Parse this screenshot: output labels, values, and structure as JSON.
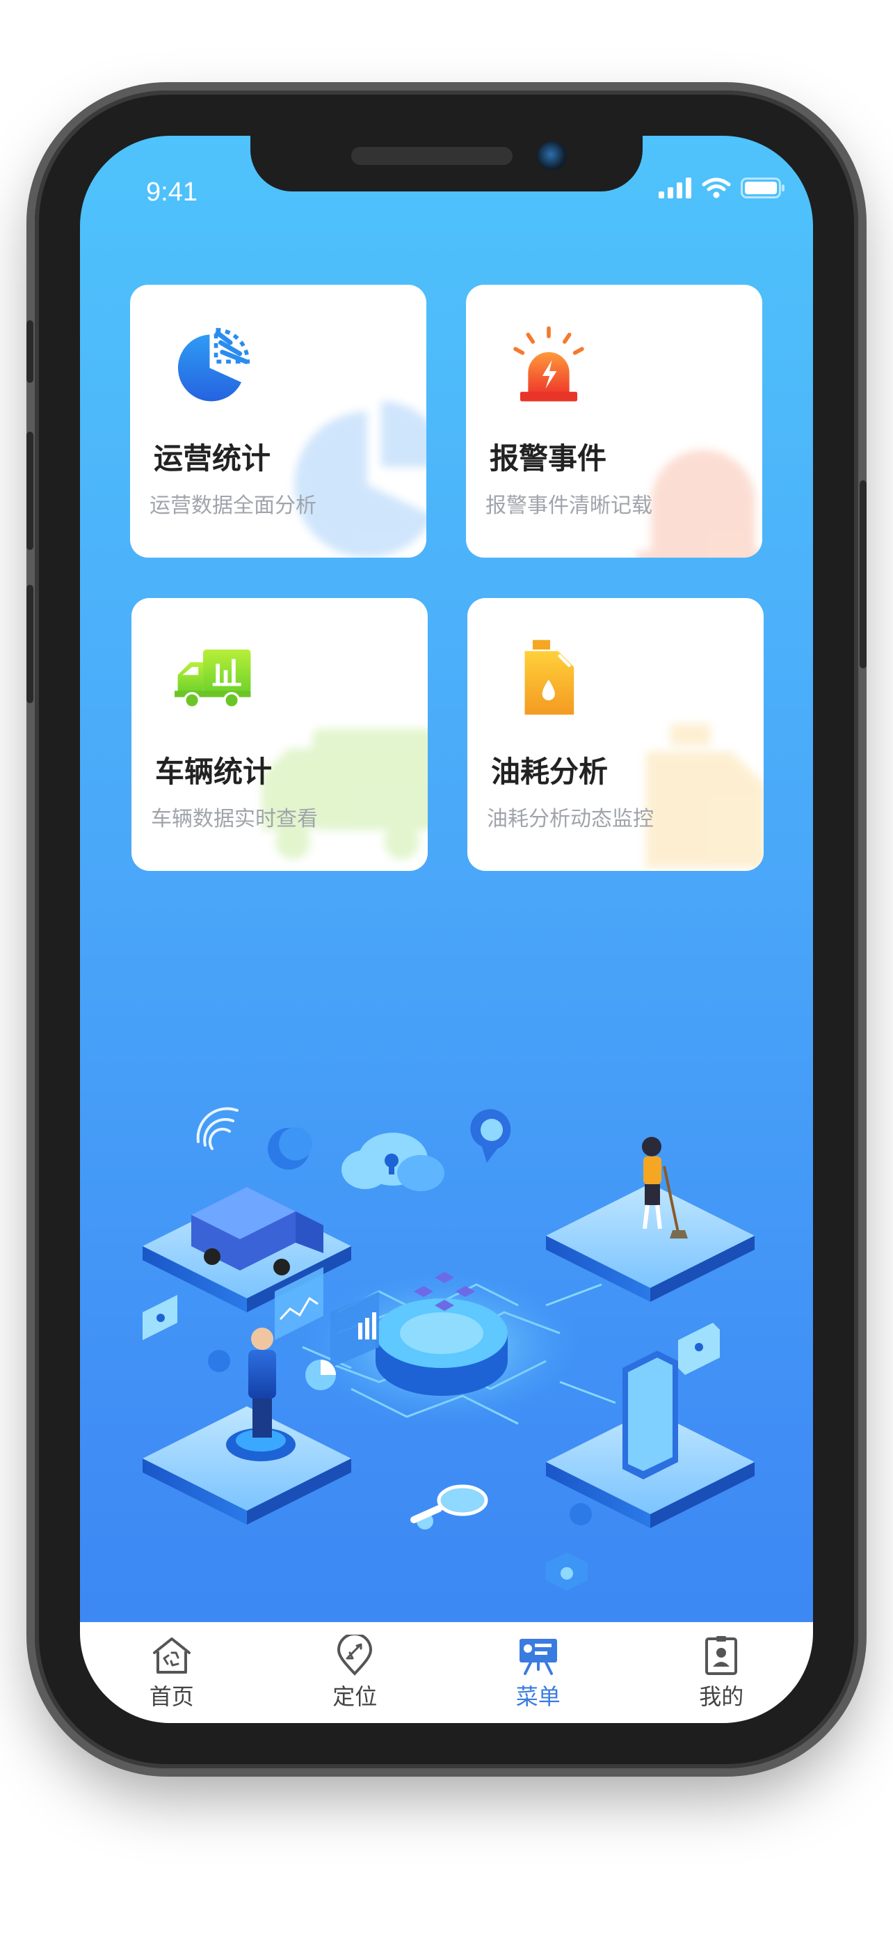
{
  "status_bar": {
    "time": "9:41"
  },
  "cards": [
    {
      "title": "运营统计",
      "desc": "运营数据全面分析",
      "icon": "pie-chart-icon"
    },
    {
      "title": "报警事件",
      "desc": "报警事件清晰记载",
      "icon": "alarm-light-icon"
    },
    {
      "title": "车辆统计",
      "desc": "车辆数据实时查看",
      "icon": "truck-icon"
    },
    {
      "title": "油耗分析",
      "desc": "油耗分析动态监控",
      "icon": "oil-can-icon"
    }
  ],
  "tabbar": {
    "items": [
      {
        "label": "首页",
        "icon": "home-recycle-icon",
        "active": false
      },
      {
        "label": "定位",
        "icon": "location-pin-icon",
        "active": false
      },
      {
        "label": "菜单",
        "icon": "menu-board-icon",
        "active": true
      },
      {
        "label": "我的",
        "icon": "profile-icon",
        "active": false
      }
    ]
  },
  "colors": {
    "accent": "#3a7be0",
    "bg_top": "#4fc3fb",
    "bg_bottom": "#3b86f2"
  }
}
